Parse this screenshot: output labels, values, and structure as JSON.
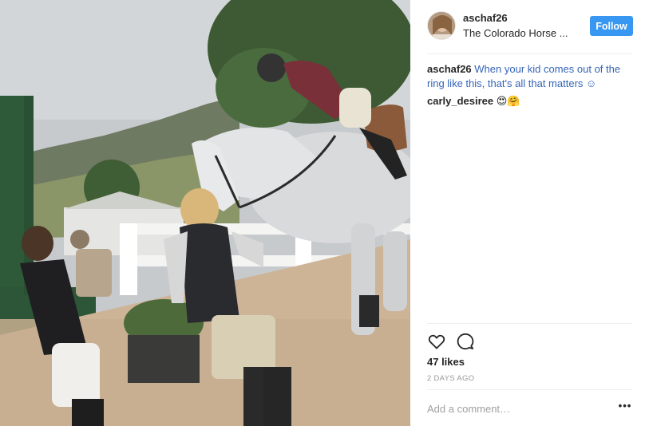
{
  "post": {
    "photo_alt": "",
    "author": {
      "username": "aschaf26",
      "location": "The Colorado Horse ...",
      "follow_label": "Follow"
    },
    "comments": [
      {
        "user": "aschaf26",
        "text": "When your kid comes out of the ring like this, that's all that matters ☺",
        "style": "link"
      },
      {
        "user": "carly_desiree",
        "text": "😍🤗",
        "style": "plain"
      }
    ],
    "icons": {
      "like": "heart-outline-icon",
      "comment": "speech-bubble-icon",
      "more": "ellipsis-icon"
    },
    "likes": "47 likes",
    "date": "2 DAYS AGO",
    "add_comment_placeholder": "Add a comment…",
    "more_label": "•••",
    "colors": {
      "follow": "#3897f0",
      "link_text": "#3565b8",
      "muted": "#999999"
    }
  }
}
